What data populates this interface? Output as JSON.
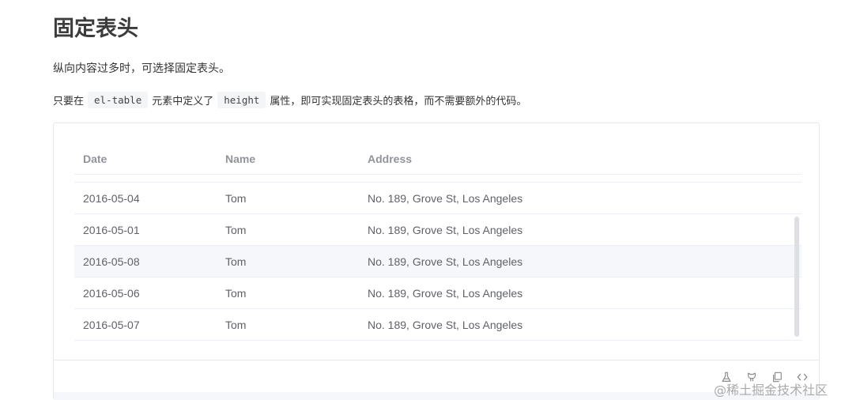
{
  "page": {
    "title": "固定表头",
    "desc1": "纵向内容过多时，可选择固定表头。",
    "desc2_part1": "只要在",
    "desc2_code1": "el-table",
    "desc2_part2": "元素中定义了",
    "desc2_code2": "height",
    "desc2_part3": "属性，即可实现固定表头的表格，而不需要额外的代码。"
  },
  "table": {
    "headers": {
      "date": "Date",
      "name": "Name",
      "address": "Address"
    },
    "rows": [
      {
        "date": "2016-05-04",
        "name": "Tom",
        "address": "No. 189, Grove St, Los Angeles"
      },
      {
        "date": "2016-05-01",
        "name": "Tom",
        "address": "No. 189, Grove St, Los Angeles"
      },
      {
        "date": "2016-05-08",
        "name": "Tom",
        "address": "No. 189, Grove St, Los Angeles"
      },
      {
        "date": "2016-05-06",
        "name": "Tom",
        "address": "No. 189, Grove St, Los Angeles"
      },
      {
        "date": "2016-05-07",
        "name": "Tom",
        "address": "No. 189, Grove St, Los Angeles"
      }
    ],
    "hover_row_index": 2
  },
  "toolbar": {
    "icons": [
      "flask-icon",
      "github-icon",
      "copy-icon",
      "code-icon"
    ]
  },
  "watermark": "@稀土掘金技术社区",
  "colors": {
    "header_text": "#909399",
    "cell_text": "#606266",
    "border": "#ebeef5",
    "hover_bg": "#f5f7fa"
  }
}
